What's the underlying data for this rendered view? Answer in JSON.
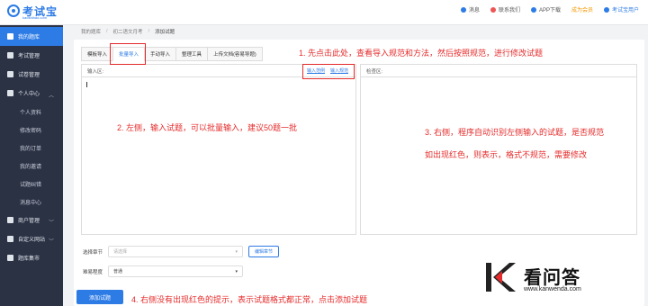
{
  "header": {
    "logo_text": "考试宝",
    "logo_sub": "kaoshibao.com",
    "items": [
      {
        "label": "消息",
        "icon": "bell-icon"
      },
      {
        "label": "联系我们",
        "icon": "contact-icon"
      },
      {
        "label": "APP下载",
        "icon": "phone-icon"
      },
      {
        "label": "成为会员",
        "icon": "vip-icon"
      },
      {
        "label": "考试宝用户",
        "icon": "user-icon"
      }
    ]
  },
  "sidebar": {
    "items": [
      {
        "label": "我的题库",
        "icon": "library-icon",
        "active": true
      },
      {
        "label": "考试管理",
        "icon": "exam-icon"
      },
      {
        "label": "试卷管理",
        "icon": "paper-icon"
      },
      {
        "label": "个人中心",
        "icon": "person-icon",
        "expanded": true
      }
    ],
    "sub_items": [
      "个人资料",
      "修改密码",
      "我的订单",
      "我的邀请",
      "试题纠错",
      "消息中心"
    ],
    "bottom_items": [
      {
        "label": "商户管理",
        "icon": "shop-icon"
      },
      {
        "label": "自定义网站",
        "icon": "globe-icon"
      },
      {
        "label": "题库集市",
        "icon": "market-icon"
      }
    ]
  },
  "breadcrumb": [
    "我的题库",
    "初二语文月考",
    "添加试题"
  ],
  "tabs": [
    "模板导入",
    "批量导入",
    "手动导入",
    "整理工具",
    "上传文档(容易导题)"
  ],
  "active_tab": 1,
  "input_box": {
    "label": "输入区:",
    "links": [
      "输入范例",
      "输入规范"
    ]
  },
  "check_box": {
    "label": "检查区:"
  },
  "notes": {
    "n1": "1. 先点击此处，查看导入规范和方法，然后按照规范，进行修改试题",
    "n2": "2. 左侧，输入试题，可以批量输入，建议50题一批",
    "n3a": "3. 右侧，程序自动识别左侧输入的试题，是否规范",
    "n3b": "如出现红色，则表示，格式不规范，需要修改",
    "n4": "4. 右侧没有出现红色的提示，表示试题格式都正常，点击添加试题"
  },
  "form": {
    "chapter_label": "选择章节",
    "chapter_placeholder": "请选择",
    "edit_chapter": "编辑章节",
    "difficulty_label": "难易程度",
    "difficulty_value": "普通"
  },
  "submit_label": "添加试题",
  "watermark": {
    "title": "看问答",
    "url": "www.kanwenda.com"
  },
  "colors": {
    "accent": "#2d7be5",
    "sidebar": "#2b3244",
    "note_red": "#e52b2b",
    "vip_orange": "#f39800"
  }
}
